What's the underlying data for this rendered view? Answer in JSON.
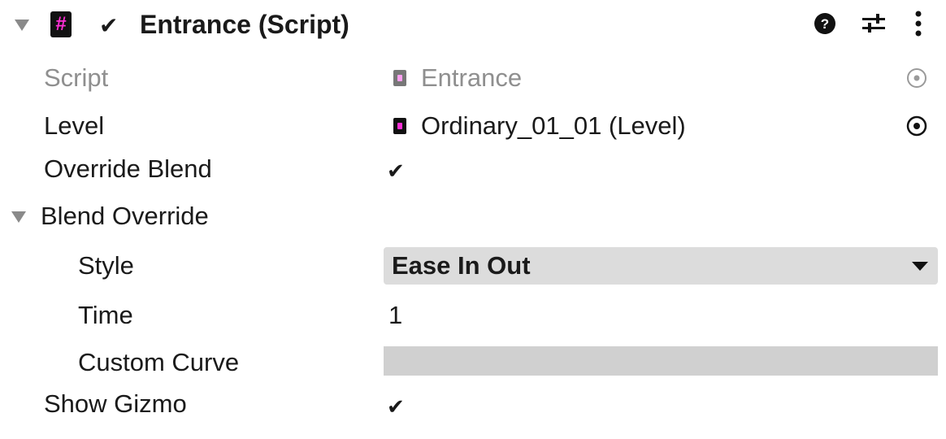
{
  "header": {
    "title": "Entrance (Script)",
    "enabled_check": "✔",
    "script_icon_glyph": "#",
    "icons": [
      "help-icon",
      "preset-sliders-icon",
      "context-menu-icon"
    ]
  },
  "fields": {
    "script": {
      "label": "Script",
      "value": "Entrance"
    },
    "level": {
      "label": "Level",
      "value": "Ordinary_01_01 (Level)"
    },
    "override_blend": {
      "label": "Override Blend",
      "check": "✔"
    },
    "blend_override": {
      "label": "Blend Override",
      "style": {
        "label": "Style",
        "value": "Ease In Out"
      },
      "time": {
        "label": "Time",
        "value": "1"
      },
      "custom_curve": {
        "label": "Custom Curve"
      }
    },
    "show_gizmo": {
      "label": "Show Gizmo",
      "check": "✔"
    }
  },
  "colors": {
    "script_icon_accent": "#ff2fd6",
    "dropdown_bg": "#dcdcdc",
    "curve_field_bg": "#d0d0d0",
    "disabled_text": "#8f8f8f"
  }
}
